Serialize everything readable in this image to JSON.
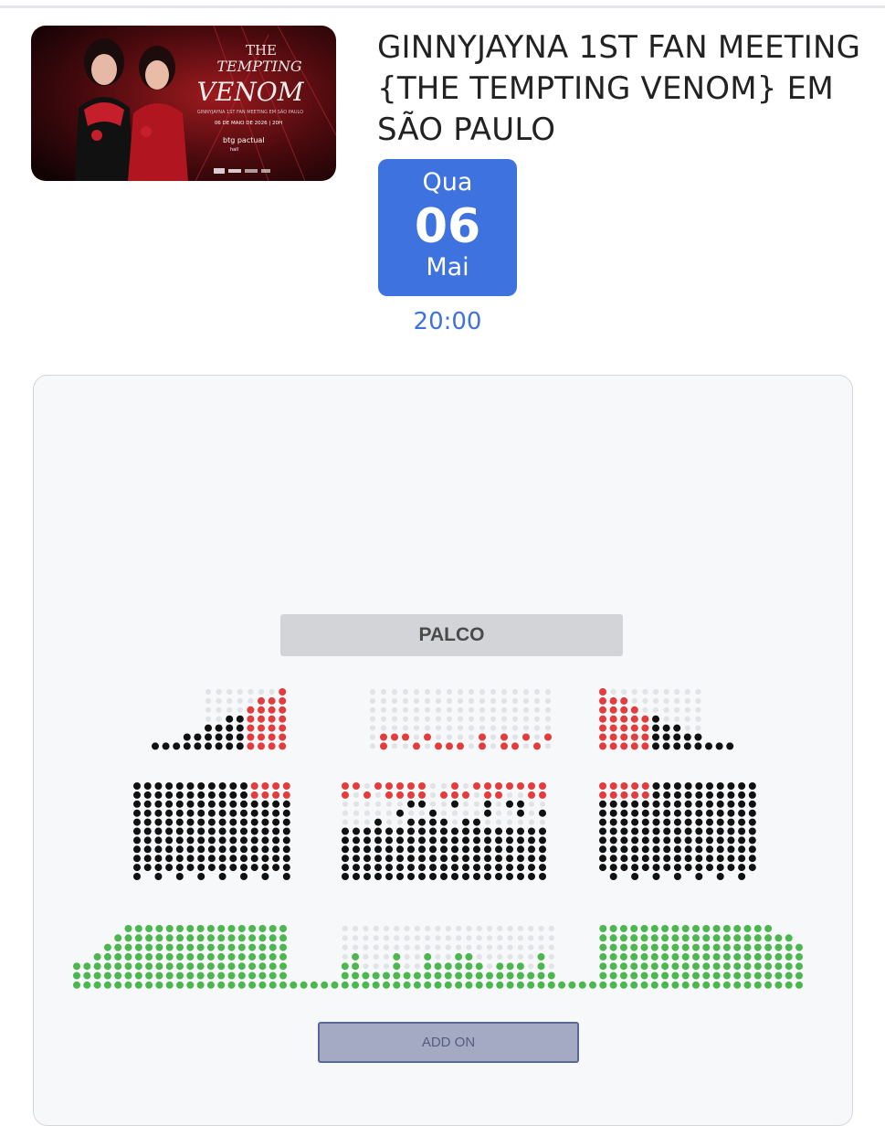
{
  "event": {
    "title": "GINNYJAYNA 1ST FAN MEETING {THE TEMPTING VENOM} EM SÃO PAULO",
    "poster": {
      "headline_line1": "THE",
      "headline_line2": "TEMPTING",
      "headline_line3": "VENOM",
      "subtitle": "GINNYJAYNA 1ST FAN MEETING EM SÃO PAULO",
      "date_text": "06 DE MAIO DE 2026 | 20H",
      "venue_logo_text": "btg pactual",
      "venue_logo_sub": "hall"
    },
    "date": {
      "weekday": "Qua",
      "day": "06",
      "month": "Mai"
    },
    "time": "20:00"
  },
  "seatmap": {
    "stage_label": "PALCO",
    "addon_label": "ADD ON",
    "colors": {
      "available_red": "#e23c3c",
      "sold_black": "#111111",
      "unavailable_gray": "#e2e3e6",
      "green": "#4cb74e"
    }
  },
  "theme": {
    "accent_blue": "#3e72df",
    "card_bg": "#f7f8fa"
  }
}
